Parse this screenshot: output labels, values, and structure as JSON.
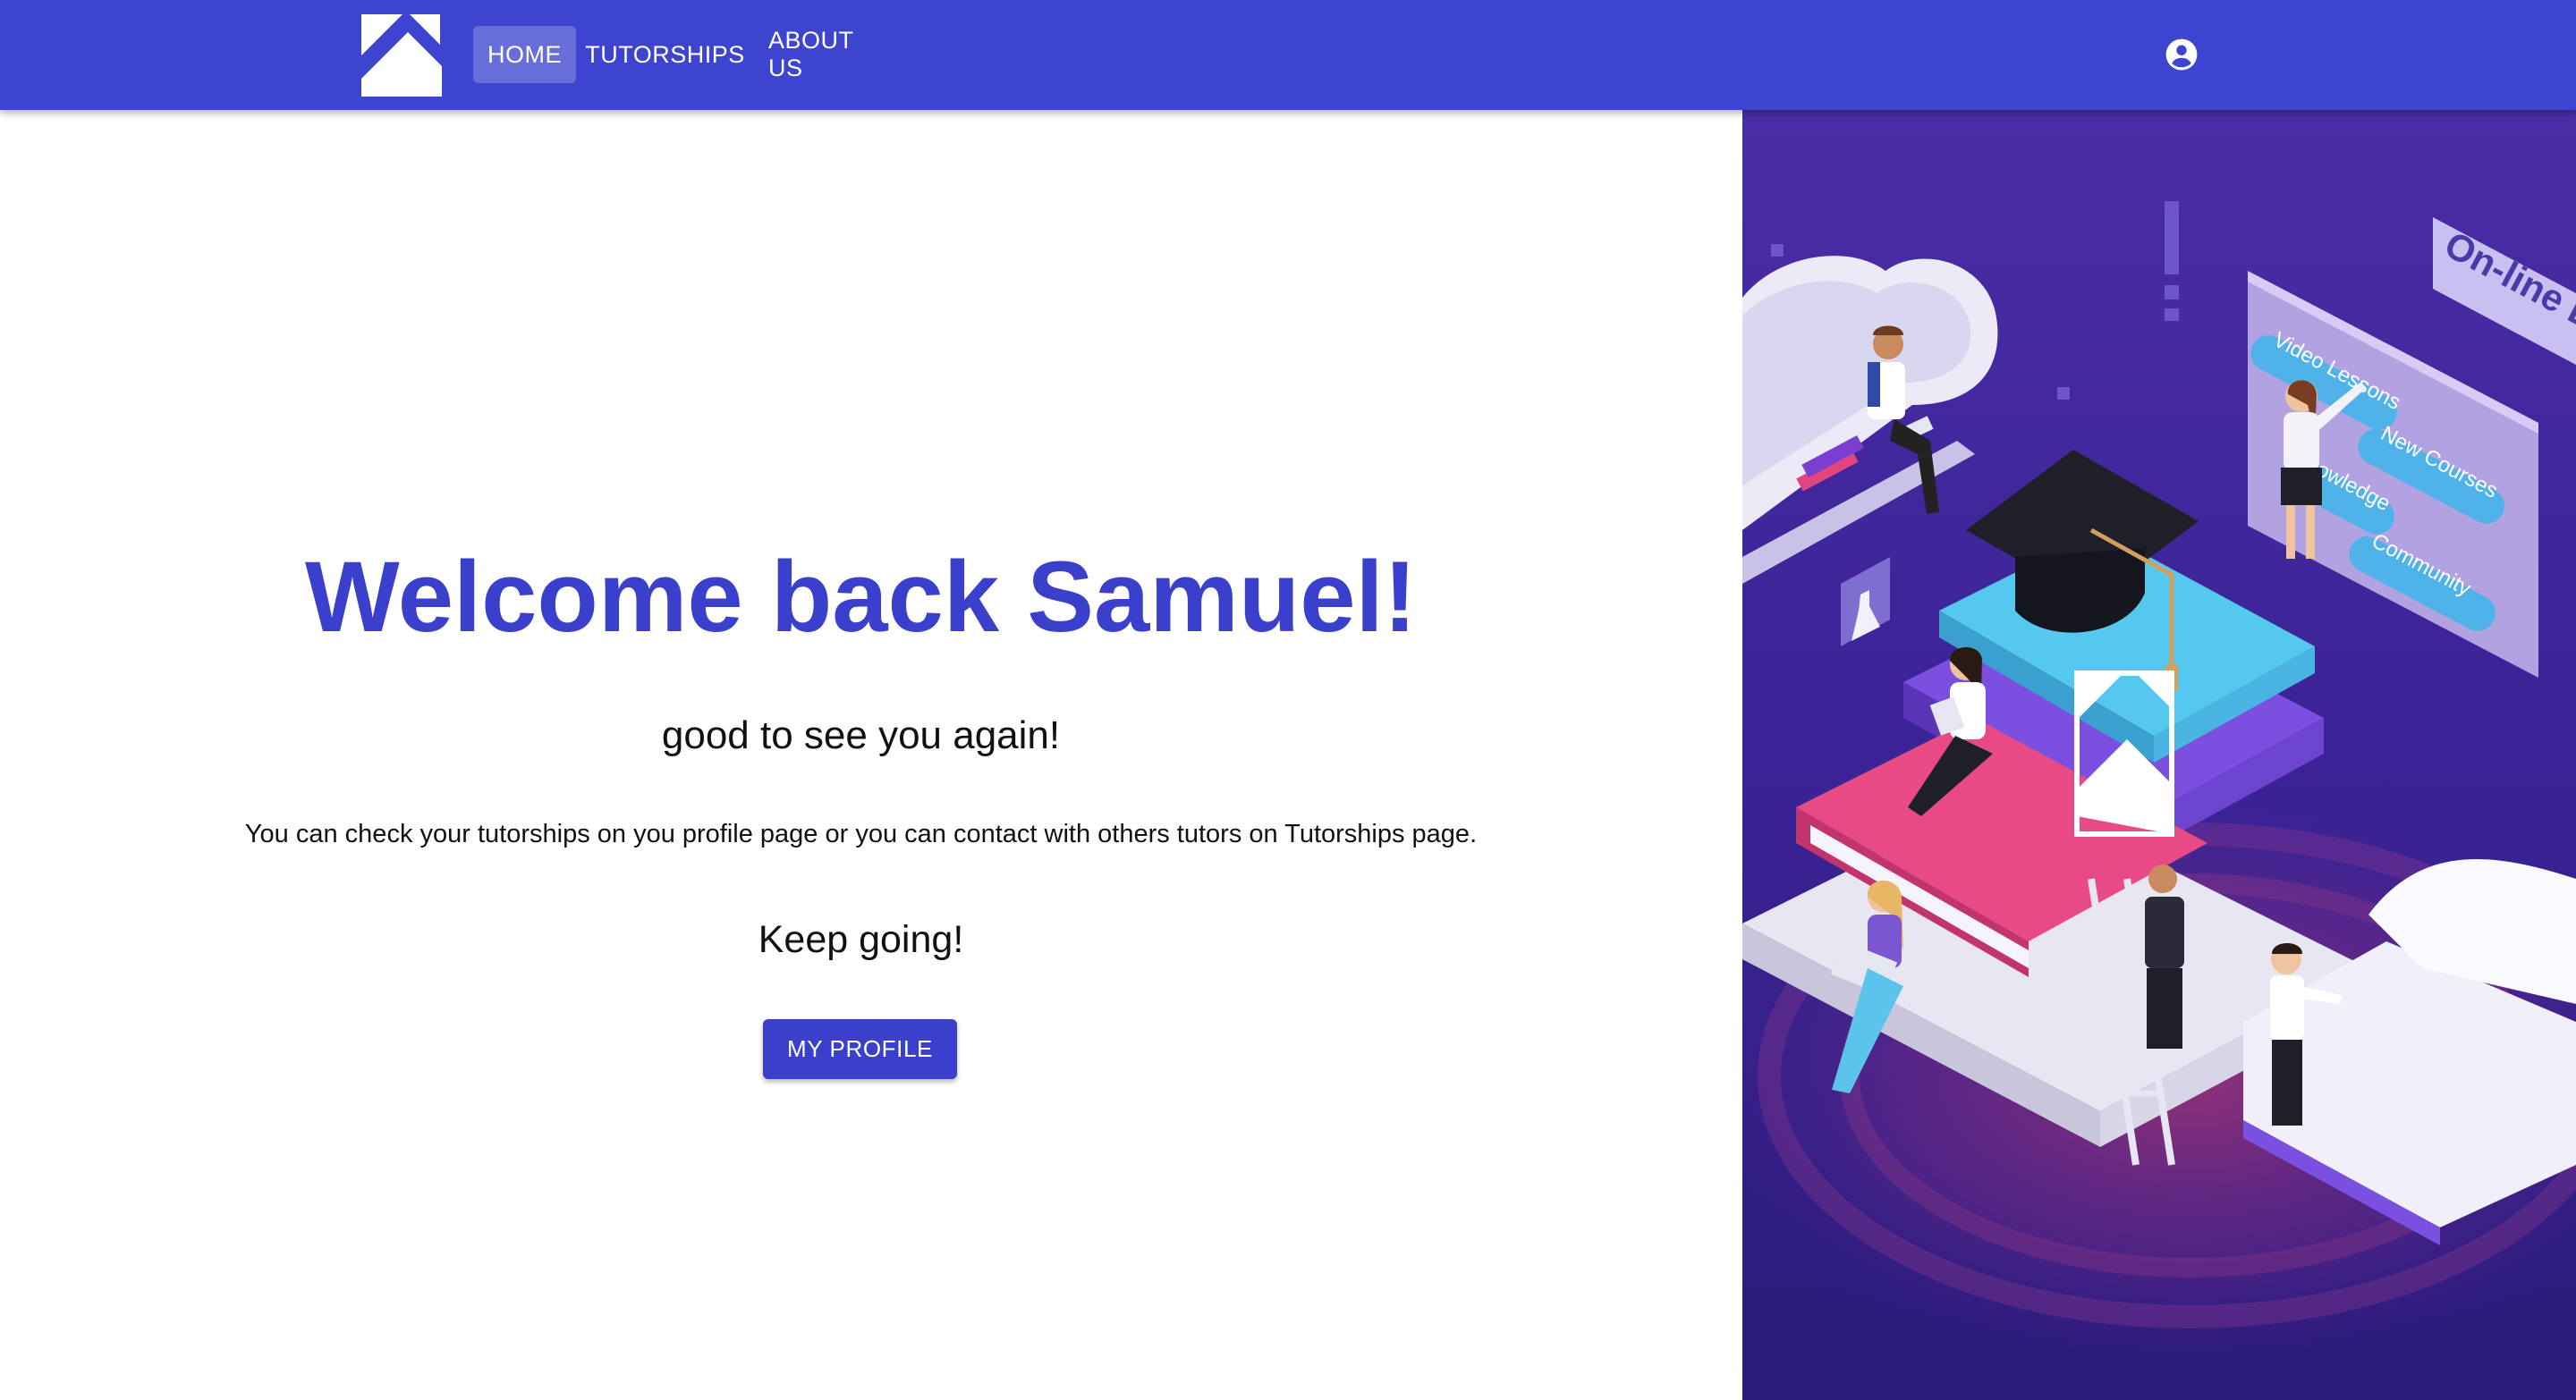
{
  "appbar": {
    "logo_icon": "brand-logo-icon",
    "nav": [
      {
        "label": "HOME",
        "active": true
      },
      {
        "label": "TUTORSHIPS",
        "active": false
      },
      {
        "label": "ABOUT US",
        "active": false
      }
    ],
    "account_icon": "account-circle-icon"
  },
  "main": {
    "title": "Welcome back Samuel!",
    "subtitle": "good to see you again!",
    "message": "You can check your tutorships on you profile page or you can contact with others tutors on Tutorships page.",
    "closing": "Keep going!",
    "profile_button": "MY PROFILE"
  },
  "illustration": {
    "board_title": "On-line E",
    "board_items": [
      "Video Lessons",
      "New Courses",
      "owledge",
      "Community"
    ]
  },
  "colors": {
    "primary": "#3d44cf",
    "title": "#3a3fcc",
    "illustration_bg_top": "#3d2fa8",
    "illustration_bg_bottom": "#2a1c7a"
  }
}
